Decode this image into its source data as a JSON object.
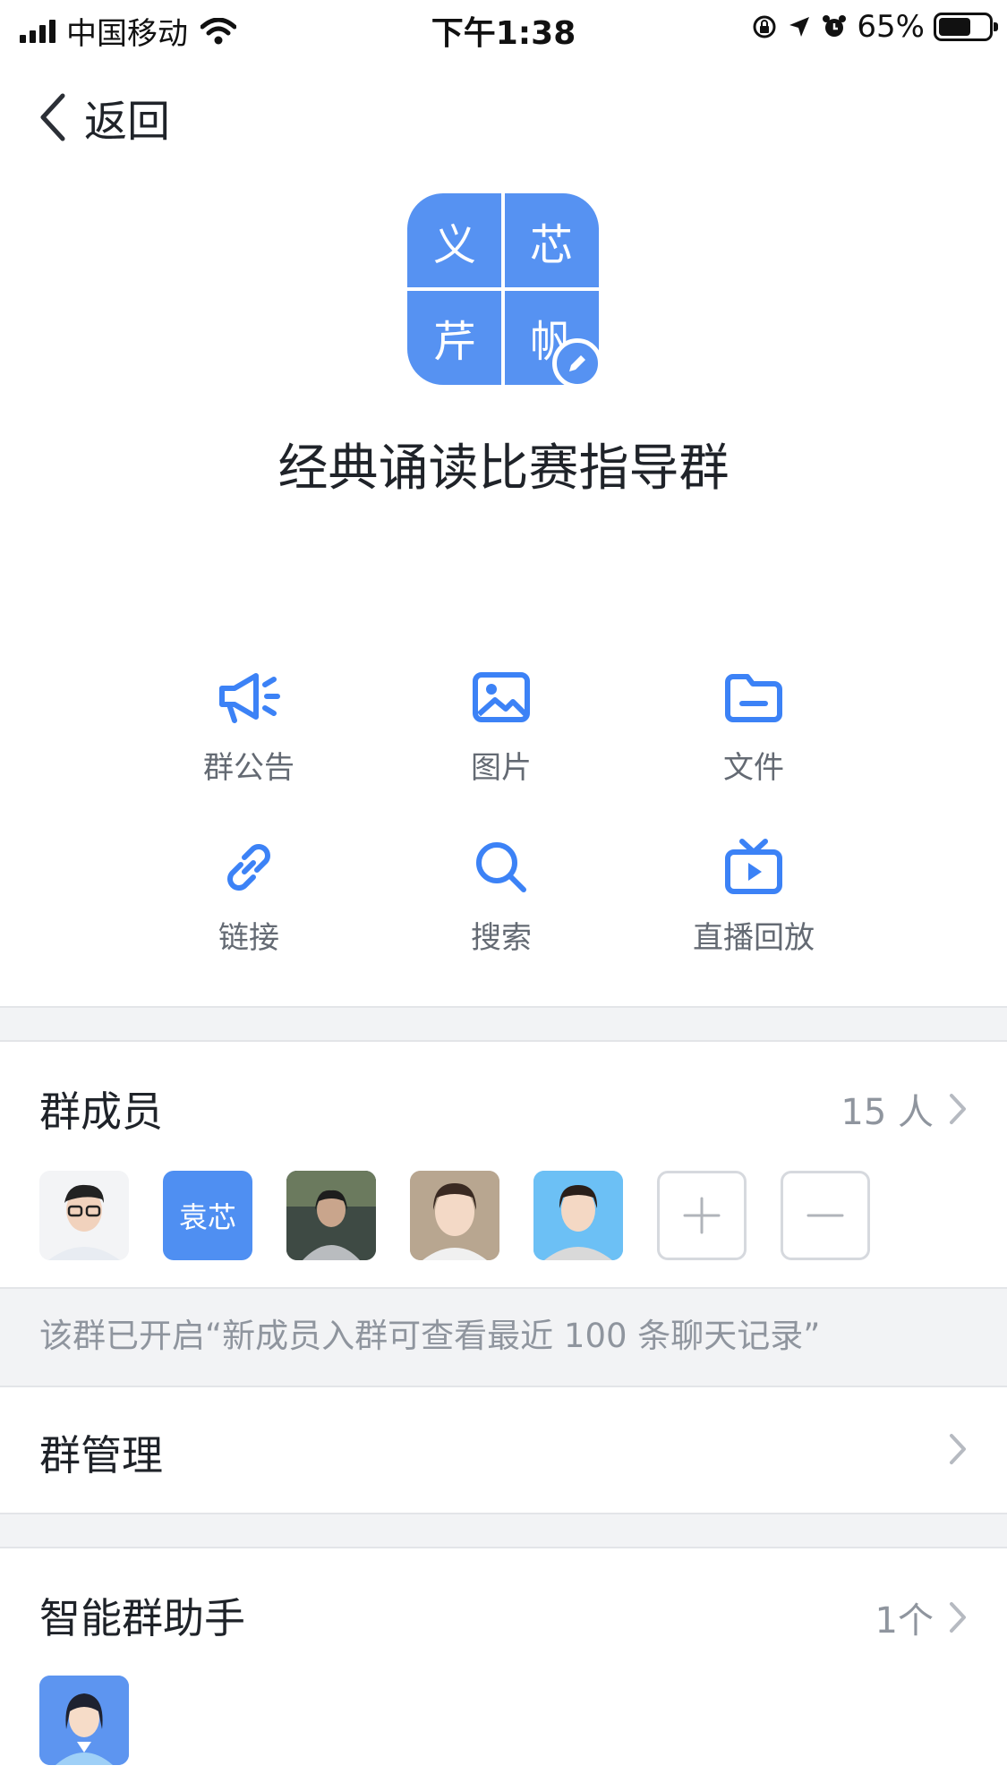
{
  "status_bar": {
    "carrier": "中国移动",
    "time": "下午1:38",
    "battery_percent_text": "65%",
    "battery_level": 0.65,
    "icons": [
      "signal-icon",
      "wifi-icon",
      "rotation-lock-icon",
      "location-icon",
      "alarm-icon",
      "battery-icon"
    ]
  },
  "nav": {
    "back_label": "返回"
  },
  "group": {
    "avatar_chars": [
      "义",
      "芯",
      "芹",
      "帆"
    ],
    "name": "经典诵读比赛指导群",
    "avatar_color": "#5692f2"
  },
  "features": [
    {
      "label": "群公告",
      "icon": "megaphone-icon"
    },
    {
      "label": "图片",
      "icon": "image-icon"
    },
    {
      "label": "文件",
      "icon": "folder-icon"
    },
    {
      "label": "链接",
      "icon": "link-icon"
    },
    {
      "label": "搜索",
      "icon": "search-icon"
    },
    {
      "label": "直播回放",
      "icon": "tv-replay-icon"
    }
  ],
  "members": {
    "title": "群成员",
    "count_text": "15 人",
    "text_avatar": "袁芯",
    "add_icon": "plus-icon",
    "remove_icon": "minus-icon"
  },
  "notice": {
    "text": "该群已开启“新成员入群可查看最近 100 条聊天记录”"
  },
  "management": {
    "title": "群管理"
  },
  "assistant": {
    "title": "智能群助手",
    "count_text": "1个"
  },
  "colors": {
    "accent": "#3c82f6",
    "avatar_blue": "#5692f2",
    "secondary_text": "#8f959e",
    "section_bg": "#f2f3f5"
  }
}
